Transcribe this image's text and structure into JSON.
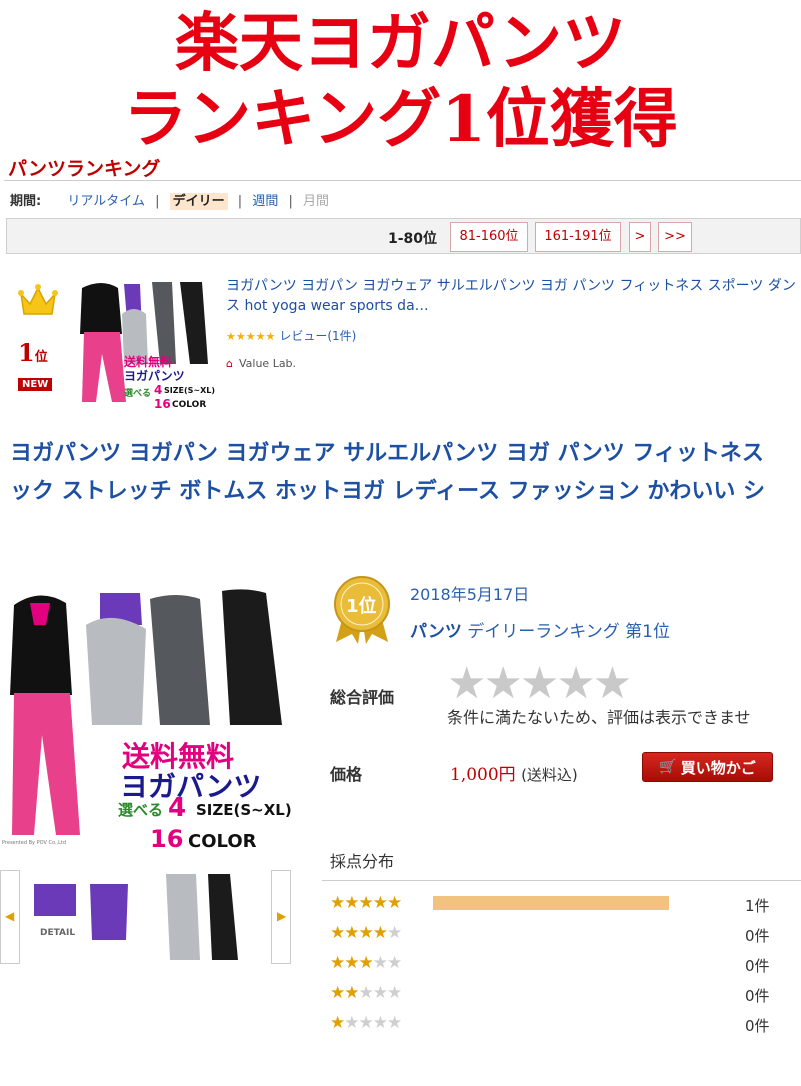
{
  "headline": {
    "line1": "楽天ヨガパンツ",
    "line2": "ランキング1位獲得"
  },
  "ranking": {
    "title": "パンツランキング",
    "period_label": "期間:",
    "periods": [
      "リアルタイム",
      "デイリー",
      "週間",
      "月間"
    ],
    "selected_period": "デイリー",
    "separator": "|",
    "current_range": "1-80位",
    "pages": [
      "81-160位",
      "161-191位",
      ">",
      ">>"
    ]
  },
  "ranked_item": {
    "rank": "1",
    "rank_suffix": "位",
    "badge": "NEW",
    "title": "ヨガパンツ ヨガパン ヨガウェア サルエルパンツ ヨガ パンツ フィットネス スポーツ ダンス hot yoga wear sports da…",
    "stars": "★★★★★",
    "review": "レビュー(1件)",
    "shop": "Value Lab.",
    "thumb_text": [
      "送料無料",
      "ヨガパンツ",
      "選べる",
      "4",
      "SIZE(S~XL)",
      "16",
      "COLOR"
    ]
  },
  "product_title": {
    "line1": "ヨガパンツ ヨガパン ヨガウェア サルエルパンツ ヨガ パンツ フィットネス",
    "line2": "ック ストレッチ ボトムス ホットヨガ レディース ファッション かわいい シ"
  },
  "product": {
    "main_image_text": [
      "送料無料",
      "ヨガパンツ",
      "選べる",
      "4",
      "SIZE(S~XL)",
      "16",
      "COLOR",
      "Presented By POV Co.,Ltd"
    ],
    "detail_label": "DETAIL",
    "medal_text": "1位",
    "date": "2018年5月17日",
    "category": "パンツ",
    "ranking_text": "デイリーランキング 第1位",
    "overall_label": "総合評価",
    "overall_stars": "★★★★★",
    "overall_note": "条件に満たないため、評価は表示できませ",
    "price_label": "価格",
    "price": "1,000円",
    "shipping": "(送料込)",
    "cart_button": "買い物かご",
    "distribution_title": "採点分布"
  },
  "distribution": [
    {
      "stars": 5,
      "count": "1件",
      "fraction": 1.0
    },
    {
      "stars": 4,
      "count": "0件",
      "fraction": 0
    },
    {
      "stars": 3,
      "count": "0件",
      "fraction": 0
    },
    {
      "stars": 2,
      "count": "0件",
      "fraction": 0
    },
    {
      "stars": 1,
      "count": "0件",
      "fraction": 0
    }
  ],
  "colors": {
    "accent_red": "#e60012",
    "rakuten_red": "#bf0000",
    "link_blue": "#1d4fa2",
    "star_gold": "#e0a000",
    "bar_fill": "#f2c37f"
  }
}
